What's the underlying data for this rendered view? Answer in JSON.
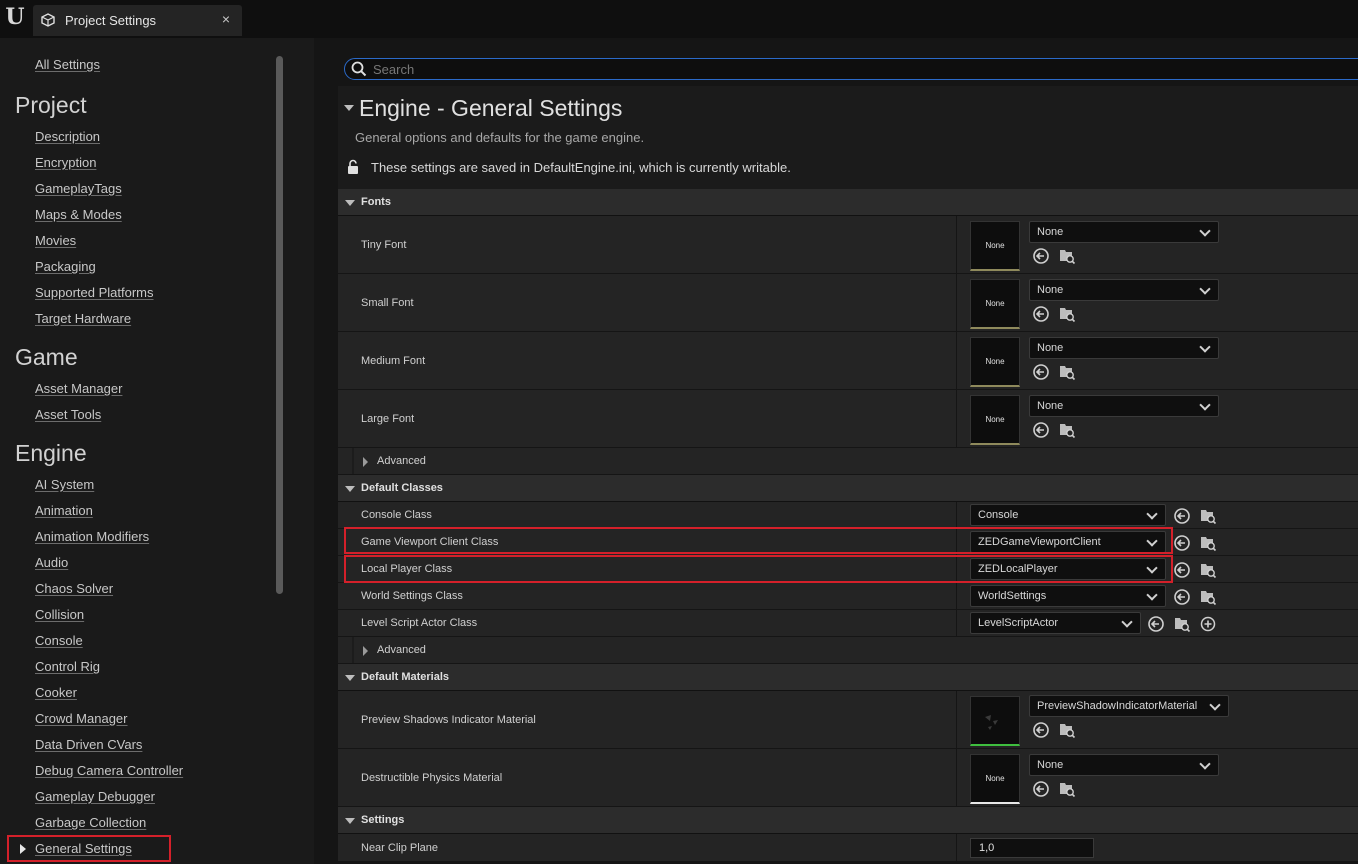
{
  "titlebar": {
    "tab_title": "Project Settings",
    "close_glyph": "×",
    "logo_text": "U"
  },
  "sidebar": {
    "all_settings": "All Settings",
    "sections": {
      "project": "Project",
      "game": "Game",
      "engine": "Engine"
    },
    "project_items": [
      "Description",
      "Encryption",
      "GameplayTags",
      "Maps & Modes",
      "Movies",
      "Packaging",
      "Supported Platforms",
      "Target Hardware"
    ],
    "game_items": [
      "Asset Manager",
      "Asset Tools"
    ],
    "engine_items": [
      "AI System",
      "Animation",
      "Animation Modifiers",
      "Audio",
      "Chaos Solver",
      "Collision",
      "Console",
      "Control Rig",
      "Cooker",
      "Crowd Manager",
      "Data Driven CVars",
      "Debug Camera Controller",
      "Gameplay Debugger",
      "Garbage Collection",
      "General Settings"
    ],
    "active_item": "General Settings"
  },
  "search": {
    "placeholder": "Search"
  },
  "header": {
    "title": "Engine - General Settings",
    "description": "General options and defaults for the game engine.",
    "save_note": "These settings are saved in DefaultEngine.ini, which is currently writable."
  },
  "categories": {
    "fonts": "Fonts",
    "default_classes": "Default Classes",
    "default_materials": "Default Materials",
    "settings": "Settings",
    "advanced": "Advanced"
  },
  "fonts": [
    {
      "label": "Tiny Font",
      "thumb": "None",
      "value": "None"
    },
    {
      "label": "Small Font",
      "thumb": "None",
      "value": "None"
    },
    {
      "label": "Medium Font",
      "thumb": "None",
      "value": "None"
    },
    {
      "label": "Large Font",
      "thumb": "None",
      "value": "None"
    }
  ],
  "classes": [
    {
      "label": "Console Class",
      "value": "Console"
    },
    {
      "label": "Game Viewport Client Class",
      "value": "ZEDGameViewportClient"
    },
    {
      "label": "Local Player Class",
      "value": "ZEDLocalPlayer"
    },
    {
      "label": "World Settings Class",
      "value": "WorldSettings"
    },
    {
      "label": "Level Script Actor Class",
      "value": "LevelScriptActor"
    }
  ],
  "materials": [
    {
      "label": "Preview Shadows Indicator Material",
      "value": "PreviewShadowIndicatorMaterial",
      "thumb": ""
    },
    {
      "label": "Destructible Physics Material",
      "value": "None",
      "thumb": "None"
    }
  ],
  "settings_rows": [
    {
      "label": "Near Clip Plane",
      "value": "1,0"
    }
  ],
  "colors": {
    "highlight": "#d4202a",
    "search_border": "#2b6ac9",
    "panel": "#242424",
    "category": "#2c2c2c"
  }
}
